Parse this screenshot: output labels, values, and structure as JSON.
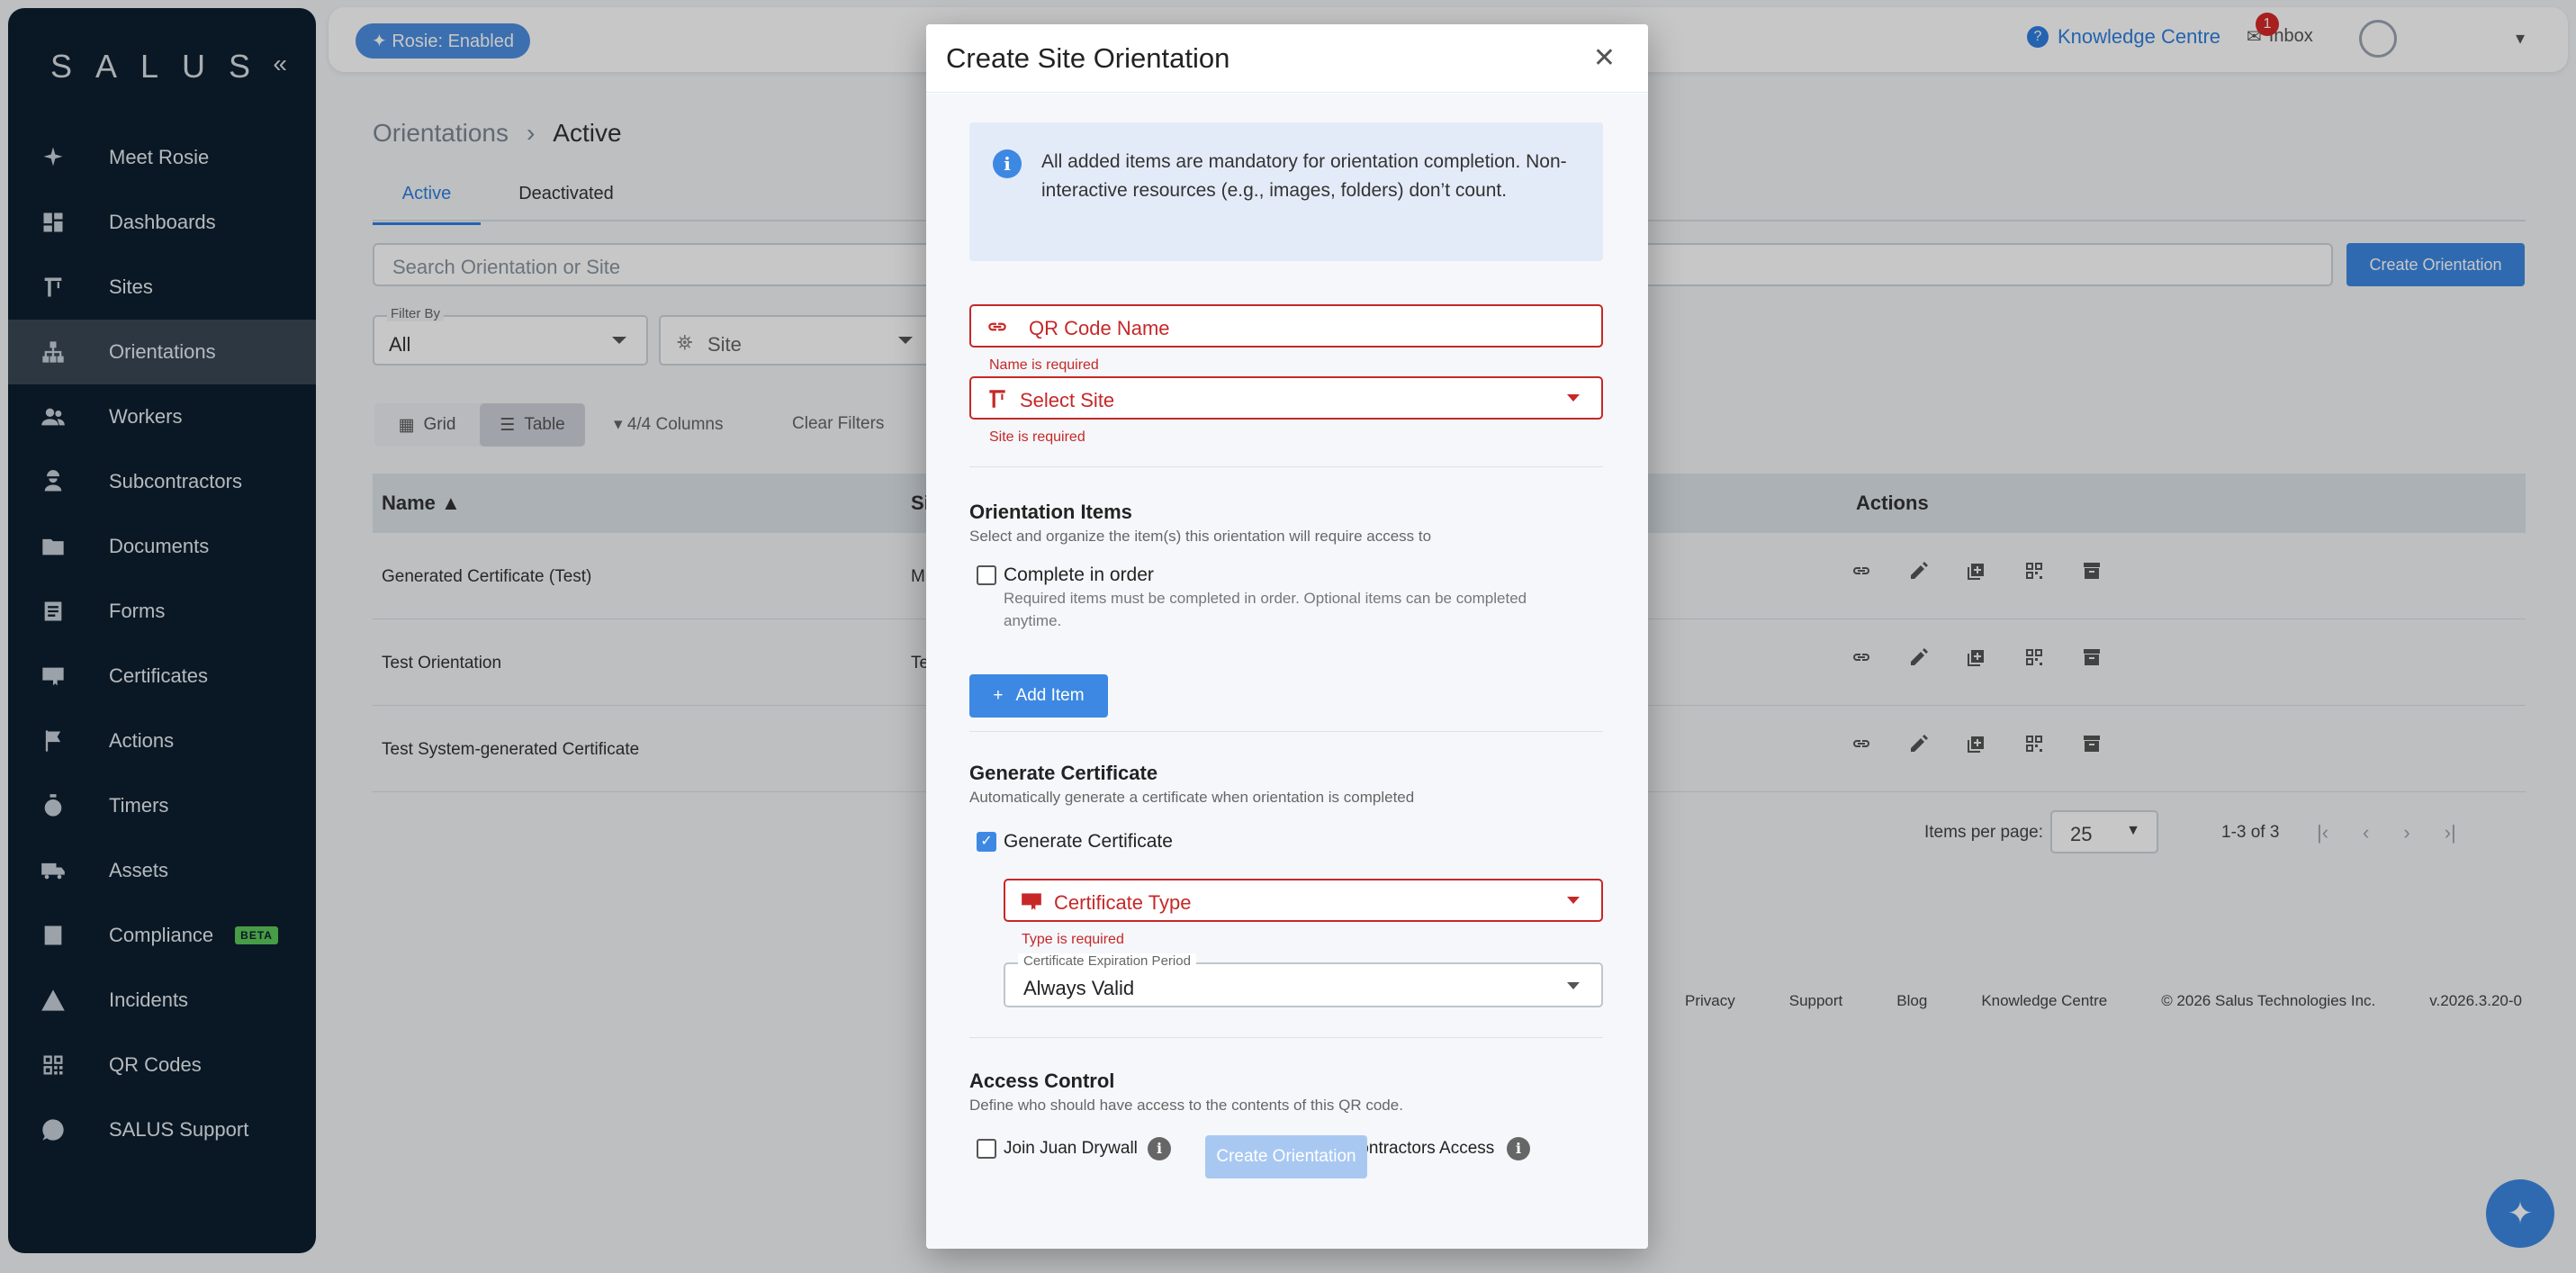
{
  "sidebar": {
    "logo": "SALUS",
    "collapse_icon": "double-chevron-left-icon",
    "items": [
      {
        "label": "Meet Rosie",
        "icon": "sparkle-icon"
      },
      {
        "label": "Dashboards",
        "icon": "dashboard-icon"
      },
      {
        "label": "Sites",
        "icon": "crane-icon"
      },
      {
        "label": "Orientations",
        "icon": "hierarchy-icon",
        "active": true
      },
      {
        "label": "Workers",
        "icon": "people-icon"
      },
      {
        "label": "Subcontractors",
        "icon": "worker-icon"
      },
      {
        "label": "Documents",
        "icon": "folder-icon"
      },
      {
        "label": "Forms",
        "icon": "form-icon"
      },
      {
        "label": "Certificates",
        "icon": "certificate-icon"
      },
      {
        "label": "Actions",
        "icon": "flag-icon"
      },
      {
        "label": "Timers",
        "icon": "stopwatch-icon"
      },
      {
        "label": "Assets",
        "icon": "truck-icon"
      },
      {
        "label": "Compliance",
        "icon": "checklist-icon",
        "badge": "BETA"
      },
      {
        "label": "Incidents",
        "icon": "warning-icon"
      },
      {
        "label": "QR Codes",
        "icon": "qr-icon"
      },
      {
        "label": "SALUS Support",
        "icon": "help-chat-icon"
      }
    ]
  },
  "topbar": {
    "rosie_chip": "Rosie: Enabled",
    "knowledge_centre": "Knowledge Centre",
    "inbox": "Inbox",
    "inbox_count": "1"
  },
  "main": {
    "breadcrumb": [
      "Orientations",
      "Active"
    ],
    "tabs": [
      "Active",
      "Deactivated"
    ],
    "search_placeholder": "Search Orientation or Site",
    "create_button": "Create Orientation",
    "filter_by_label": "Filter By",
    "filter_by_value": "All",
    "site_filter": "Site",
    "view_grid": "Grid",
    "view_table": "Table",
    "columns": "4/4 Columns",
    "clear_filters": "Clear Filters",
    "table": {
      "headers": [
        "Name",
        "Si",
        "Actions"
      ],
      "rows": [
        {
          "name": "Generated Certificate (Test)",
          "site": "M"
        },
        {
          "name": "Test Orientation",
          "site": "Te"
        },
        {
          "name": "Test System-generated Certificate",
          "site": ""
        }
      ]
    },
    "pager": {
      "label": "Items per page:",
      "per_page": "25",
      "range": "1-3 of 3"
    },
    "footer": [
      "Privacy",
      "Support",
      "Blog",
      "Knowledge Centre",
      "© 2026 Salus Technologies Inc.",
      "v.2026.3.20-0"
    ]
  },
  "modal": {
    "title": "Create Site Orientation",
    "info": "All added items are mandatory for orientation completion. Non-interactive resources (e.g., images, folders) don’t count.",
    "qr_name_placeholder": "QR Code Name",
    "name_error": "Name is required",
    "site_placeholder": "Select Site",
    "site_error": "Site is required",
    "items_title": "Orientation Items",
    "items_sub": "Select and organize the item(s) this orientation will require access to",
    "complete_in_order": "Complete in order",
    "complete_hint": "Required items must be completed in order. Optional items can be completed anytime.",
    "add_item": "Add Item",
    "cert_title": "Generate Certificate",
    "cert_sub": "Automatically generate a certificate when orientation is completed",
    "generate_certificate": "Generate Certificate",
    "generate_checked": true,
    "cert_type_placeholder": "Certificate Type",
    "type_error": "Type is required",
    "expiry_label": "Certificate Expiration Period",
    "expiry_value": "Always Valid",
    "access_title": "Access Control",
    "access_sub": "Define who should have access to the contents of this QR code.",
    "join_label": "Join Juan Drywall",
    "subcontractors_label": "Subcontractors Access",
    "submit": "Create Orientation"
  }
}
